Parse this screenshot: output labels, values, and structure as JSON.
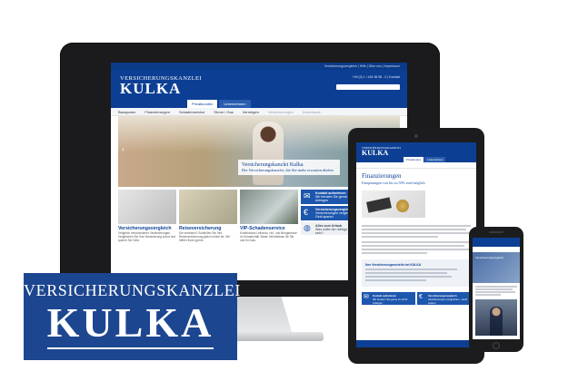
{
  "brand": {
    "line1": "VERSICHERUNGSKANZLEI",
    "line2": "KULKA"
  },
  "desktop_site": {
    "top_links": "Versicherungsvergleich | Hilfe | Über uns | Impressum",
    "contact": "+49 (0) 1 / 444 58 98 - 0  |  Kontakt",
    "tabs": [
      "Privatkunden",
      "Unternehmen"
    ],
    "nav": [
      "Bausparen",
      "Finanzierungen",
      "Schadenservice",
      "Strom / Gas",
      "Vermögen",
      "Versicherungen",
      "Downloads"
    ],
    "hero": {
      "title": "Versicherungskanzlei Kulka",
      "subtitle": "Die Versicherungskanzlei, die Sie mehr erwarten dürfen"
    },
    "cards": [
      {
        "title": "Versicherungsvergleich",
        "text": "Vergleich verschiedener Versicherungen. Vergleichen Sie Ihre Versicherung sofort und sparen Sie Geld."
      },
      {
        "title": "Reiseversicherung",
        "text": "Sie verreisen? Schließen Sie Ihre Reiseversicherung gleich online ab. Wir helfen Ihnen gerne."
      },
      {
        "title": "VIP-Schadenservice",
        "text": "Kostenloses Leihauto, Hol- und Bringservice im Schadenfall. Beste Verhältnisse für Sie und Ihr Auto."
      }
    ],
    "side": [
      {
        "title": "Kontakt aufnehmen",
        "text": "Wir beraten Sie gerne zu allen Anliegen",
        "icon": "mail-icon"
      },
      {
        "title": "Versicherungsvergleich",
        "text": "Versicherungen vergleichen - Geld sparen",
        "icon": "euro-icon"
      },
      {
        "title": "Alles zum Urlaub",
        "text": "Was sollte der richtige Kredit sein?",
        "icon": "globe-icon"
      }
    ]
  },
  "tablet_site": {
    "tabs": [
      "Privatkunden",
      "Unternehmen"
    ],
    "title": "Finanzierungen",
    "subtitle": "Einsparungen von bis zu 50% sind möglich.",
    "panel_title": "Ihre Versicherungsvorteile bei KULKA",
    "boxes": [
      {
        "title": "Kontakt aufnehmen",
        "text": "Wir beraten Sie gerne zu all Ihr Anliegen",
        "icon": "mail-icon"
      },
      {
        "title": "Versicherungsvergleich",
        "text": "Versicherungen vergleichen - Geld sparen",
        "icon": "euro-icon"
      }
    ]
  },
  "phone_site": {
    "hero_caption": "Versicherungsvergleich"
  },
  "colors": {
    "brand_blue": "#0c3f93",
    "logo_blue": "#1d4690",
    "accent_blue": "#1d56ad"
  }
}
